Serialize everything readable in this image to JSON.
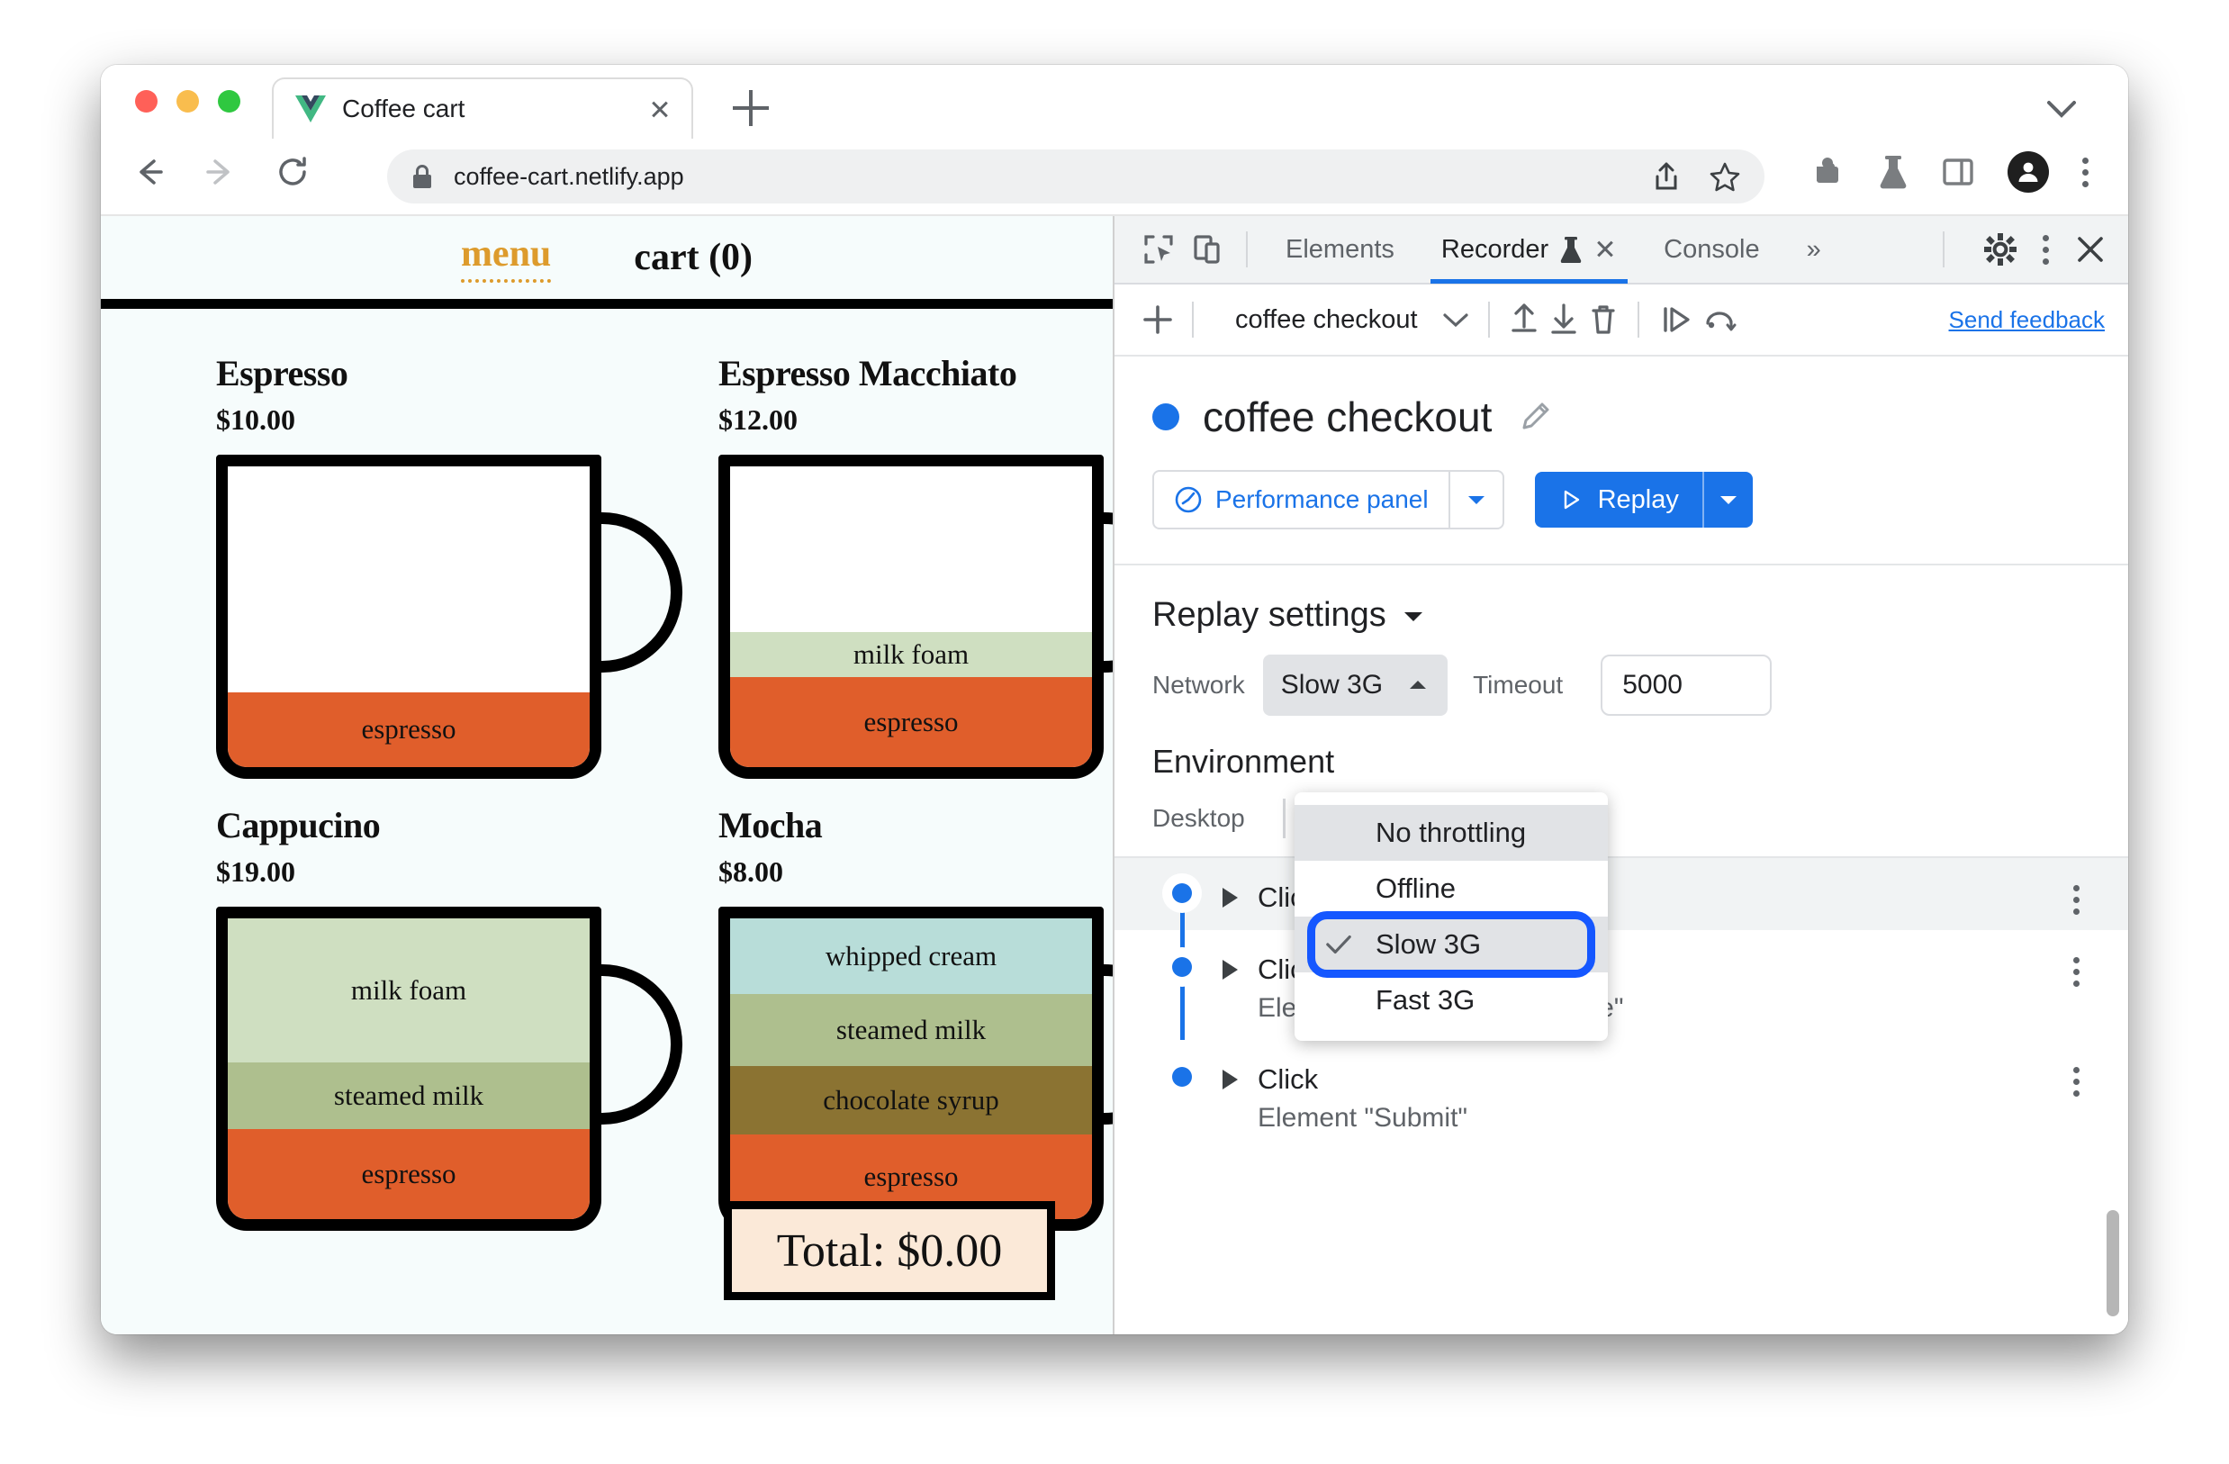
{
  "browser": {
    "tab": {
      "title": "Coffee cart",
      "favicon": "vue-logo-icon"
    },
    "url": "coffee-cart.netlify.app",
    "nav": {
      "back": "back-arrow",
      "forward": "forward-arrow",
      "reload": "reload-icon"
    },
    "toolbar_icons": [
      "share-icon",
      "star-icon",
      "extensions-puzzle-icon",
      "experiments-flask-icon",
      "side-panel-icon",
      "avatar-icon",
      "browser-menu-icon"
    ],
    "tab_search": "chevron-down-icon",
    "new_tab": "plus-icon"
  },
  "page": {
    "nav": {
      "menu": "menu",
      "cart": "cart (0)"
    },
    "products": [
      {
        "name": "Espresso",
        "price": "$10.00",
        "layers": [
          {
            "label": "",
            "color": "#ffffff",
            "height": 75
          },
          {
            "label": "espresso",
            "color": "#e05e2b",
            "height": 25
          }
        ]
      },
      {
        "name": "Espresso Macchiato",
        "price": "$12.00",
        "layers": [
          {
            "label": "",
            "color": "#ffffff",
            "height": 55
          },
          {
            "label": "milk foam",
            "color": "#cfdfc1",
            "height": 15
          },
          {
            "label": "espresso",
            "color": "#e05e2b",
            "height": 30
          }
        ]
      },
      {
        "name": "Cappucino",
        "price": "$19.00",
        "layers": [
          {
            "label": "milk foam",
            "color": "#cfdfc1",
            "height": 48
          },
          {
            "label": "steamed milk",
            "color": "#aebf8e",
            "height": 22
          },
          {
            "label": "espresso",
            "color": "#e05e2b",
            "height": 30
          }
        ]
      },
      {
        "name": "Mocha",
        "price": "$8.00",
        "layers": [
          {
            "label": "whipped cream",
            "color": "#b8ddd9",
            "height": 25
          },
          {
            "label": "steamed milk",
            "color": "#aebf8e",
            "height": 24
          },
          {
            "label": "chocolate syrup",
            "color": "#8b7332",
            "height": 23
          },
          {
            "label": "espresso",
            "color": "#e05e2b",
            "height": 28
          }
        ]
      }
    ],
    "total": "Total: $0.00"
  },
  "devtools": {
    "left_icons": [
      "inspect-element-icon",
      "device-toolbar-icon"
    ],
    "tabs": [
      {
        "label": "Elements",
        "active": false
      },
      {
        "label": "Recorder",
        "active": true,
        "experiment": true,
        "closable": true
      },
      {
        "label": "Console",
        "active": false
      }
    ],
    "more_tabs": "»",
    "right_icons": [
      "settings-gear-icon",
      "devtools-menu-icon",
      "close-devtools-icon"
    ],
    "recorder_toolbar": {
      "add": "plus-icon",
      "recording_name": "coffee checkout",
      "dropdown": "chevron-down-icon",
      "import": "import-icon",
      "export": "export-icon",
      "delete": "delete-icon",
      "step_by_step": "step-by-step-icon",
      "replay_speed": "replay-speed-icon",
      "feedback": "Send feedback"
    },
    "recording": {
      "title": "coffee checkout",
      "edit": "edit-pencil-icon",
      "performance_button": "Performance panel",
      "replay_button": "Replay",
      "settings_title": "Replay settings",
      "network_label": "Network",
      "network_value": "Slow 3G",
      "timeout_label": "Timeout",
      "timeout_value": "5000",
      "environment_label": "Environment",
      "desktop_label": "Desktop",
      "network_options": [
        {
          "label": "No throttling",
          "checked": false,
          "highlighted": true
        },
        {
          "label": "Offline",
          "checked": false,
          "highlighted": false
        },
        {
          "label": "Slow 3G",
          "checked": true,
          "highlighted": true,
          "ringed": true
        },
        {
          "label": "Fast 3G",
          "checked": false,
          "highlighted": false
        }
      ]
    },
    "steps": [
      {
        "title": "Click",
        "subtitle": "",
        "hidden_behind_dropdown": true
      },
      {
        "title": "Click",
        "subtitle": "Element \"Promotion message\""
      },
      {
        "title": "Click",
        "subtitle": "Element \"Submit\""
      }
    ]
  },
  "colors": {
    "accent": "#1a73e8",
    "ring": "#1557ff",
    "espresso": "#e05e2b",
    "gold": "#dd9b2c"
  }
}
